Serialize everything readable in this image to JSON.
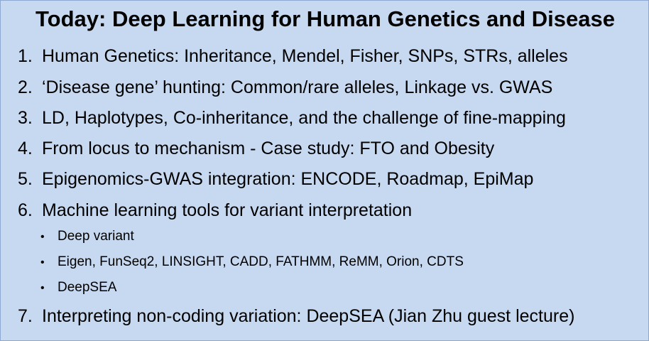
{
  "title": "Today: Deep Learning for Human Genetics and Disease",
  "items": [
    {
      "num": "1.",
      "text": "Human Genetics: Inheritance, Mendel, Fisher, SNPs, STRs, alleles"
    },
    {
      "num": "2.",
      "text": "‘Disease gene’ hunting: Common/rare alleles, Linkage vs. GWAS"
    },
    {
      "num": "3.",
      "text": "LD, Haplotypes, Co-inheritance, and the challenge of fine-mapping"
    },
    {
      "num": "4.",
      "text": "From locus to mechanism - Case study: FTO and Obesity"
    },
    {
      "num": "5.",
      "text": "Epigenomics-GWAS integration: ENCODE, Roadmap, EpiMap"
    },
    {
      "num": "6.",
      "text": "Machine learning tools for variant interpretation"
    },
    {
      "num": "7.",
      "text": "Interpreting non-coding variation: DeepSEA (Jian Zhu guest lecture)"
    }
  ],
  "subitems": [
    {
      "bullet": "•",
      "text": "Deep variant"
    },
    {
      "bullet": "•",
      "text": "Eigen, FunSeq2, LINSIGHT, CADD, FATHMM, ReMM, Orion, CDTS"
    },
    {
      "bullet": "•",
      "text": "DeepSEA"
    }
  ]
}
